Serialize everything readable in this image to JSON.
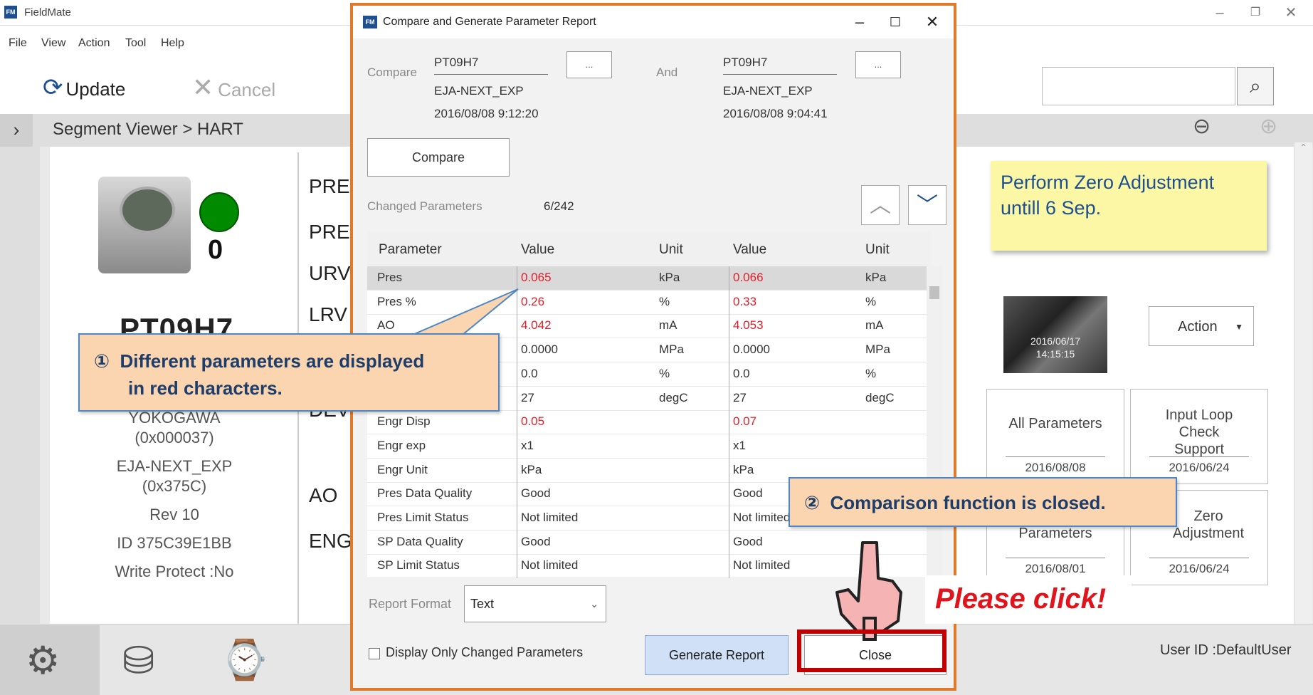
{
  "app": {
    "title": "FieldMate",
    "icon_text": "FM"
  },
  "menu": [
    "File",
    "View",
    "Action",
    "Tool",
    "Help"
  ],
  "toolbar": {
    "update_label": "Update",
    "cancel_label": "Cancel"
  },
  "breadcrumb": "Segment Viewer > HART",
  "device": {
    "tag": "PT09H7",
    "status_count": "0",
    "vendor": "YOKOGAWA",
    "vendor_code": "(0x000037)",
    "model": "EJA-NEXT_EXP",
    "model_code": "(0x375C)",
    "revision": "Rev 10",
    "id": "ID 375C39E1BB",
    "write_protect": "Write Protect :No"
  },
  "param_labels": [
    "PRES",
    "PRES",
    "URV",
    "LRV",
    "DEV",
    "AO",
    "ENG"
  ],
  "right": {
    "note": "Perform Zero Adjustment untill 6 Sep.",
    "thumb_date": "2016/06/17",
    "thumb_time": "14:15:15",
    "action_label": "Action",
    "tiles": [
      {
        "label": "All Parameters",
        "date": "2016/08/08"
      },
      {
        "label": "Input Loop Check Support",
        "date": "2016/06/24"
      },
      {
        "label": "Parameters",
        "date": "2016/08/01"
      },
      {
        "label": "Zero Adjustment",
        "date": "2016/06/24"
      }
    ]
  },
  "user_id": "User ID :DefaultUser",
  "dialog": {
    "title": "Compare and Generate Parameter Report",
    "icon_text": "FM",
    "compare_label": "Compare",
    "and_label": "And",
    "left": {
      "tag": "PT09H7",
      "model": "EJA-NEXT_EXP",
      "time": "2016/08/08 9:12:20"
    },
    "right": {
      "tag": "PT09H7",
      "model": "EJA-NEXT_EXP",
      "time": "2016/08/08 9:04:41"
    },
    "browse_label": "...",
    "compare_button": "Compare",
    "changed_label": "Changed Parameters",
    "changed_count": "6/242",
    "columns": [
      "Parameter",
      "Value",
      "Unit",
      "Value",
      "Unit"
    ],
    "rows": [
      {
        "param": "Pres",
        "v1": "0.065",
        "u1": "kPa",
        "v2": "0.066",
        "u2": "kPa",
        "changed": true,
        "selected": true
      },
      {
        "param": "Pres %",
        "v1": "0.26",
        "u1": "%",
        "v2": "0.33",
        "u2": "%",
        "changed": true
      },
      {
        "param": "AO",
        "v1": "4.042",
        "u1": "mA",
        "v2": "4.053",
        "u2": "mA",
        "changed": true
      },
      {
        "param": "",
        "v1": "0.0000",
        "u1": "MPa",
        "v2": "0.0000",
        "u2": "MPa",
        "changed": false
      },
      {
        "param": "",
        "v1": "0.0",
        "u1": "%",
        "v2": "0.0",
        "u2": "%",
        "changed": false
      },
      {
        "param": "",
        "v1": "27",
        "u1": "degC",
        "v2": "27",
        "u2": "degC",
        "changed": false
      },
      {
        "param": "Engr Disp",
        "v1": "0.05",
        "u1": "",
        "v2": "0.07",
        "u2": "",
        "changed": true
      },
      {
        "param": "Engr exp",
        "v1": "x1",
        "u1": "",
        "v2": "x1",
        "u2": "",
        "changed": false
      },
      {
        "param": "Engr Unit",
        "v1": "kPa",
        "u1": "",
        "v2": "kPa",
        "u2": "",
        "changed": false
      },
      {
        "param": "Pres Data Quality",
        "v1": "Good",
        "u1": "",
        "v2": "Good",
        "u2": "",
        "changed": false
      },
      {
        "param": "Pres Limit Status",
        "v1": "Not limited",
        "u1": "",
        "v2": "Not limited",
        "u2": "",
        "changed": false
      },
      {
        "param": "SP Data Quality",
        "v1": "Good",
        "u1": "",
        "v2": "Good",
        "u2": "",
        "changed": false
      },
      {
        "param": "SP Limit Status",
        "v1": "Not limited",
        "u1": "",
        "v2": "Not limited",
        "u2": "",
        "changed": false
      }
    ],
    "report_format_label": "Report Format",
    "report_format_value": "Text",
    "checkbox_label": "Display Only Changed Parameters",
    "generate_button": "Generate Report",
    "close_button": "Close"
  },
  "annotations": {
    "callout1_num": "①",
    "callout1_line1": "Different parameters are displayed",
    "callout1_line2": "in red characters.",
    "callout2_num": "②",
    "callout2_text": "Comparison function is closed.",
    "please_click": "Please click!"
  },
  "colors": {
    "accent": "#1d4f91",
    "changed": "#e0202a",
    "dialog_border": "#e07a2a",
    "highlight": "#c00000",
    "status_ok": "#008a00"
  }
}
